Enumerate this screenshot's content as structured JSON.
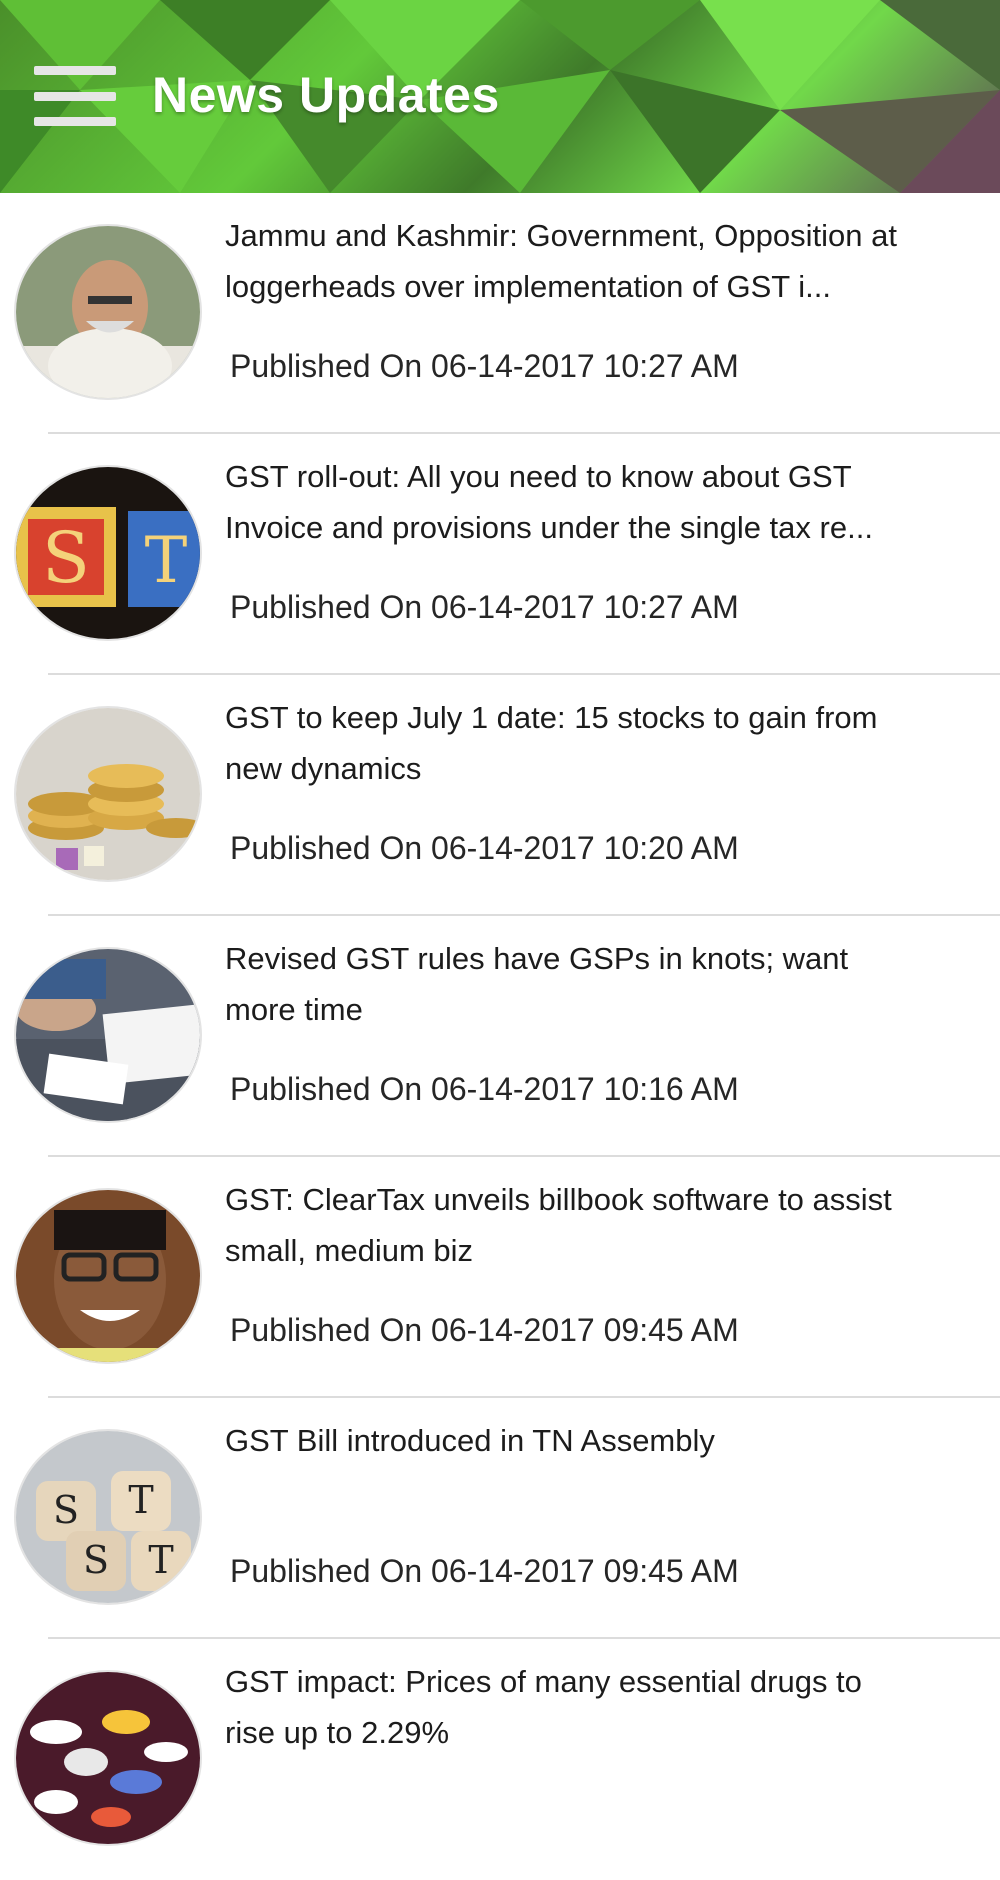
{
  "app_bar": {
    "title": "News Updates",
    "menu_icon": "hamburger-menu-icon"
  },
  "news": [
    {
      "title": "Jammu and Kashmir: Government, Opposition at loggerheads over implementation of GST i...",
      "date": "Published On 06-14-2017 10:27 AM"
    },
    {
      "title": "GST roll-out: All you need to know about GST Invoice and provisions under the single tax re...",
      "date": "Published On 06-14-2017 10:27 AM"
    },
    {
      "title": "GST to keep July 1 date: 15 stocks to gain from new dynamics",
      "date": "Published On 06-14-2017 10:20 AM"
    },
    {
      "title": "Revised GST rules have GSPs in knots; want more time",
      "date": "Published On 06-14-2017 10:16 AM"
    },
    {
      "title": "GST: ClearTax unveils billbook software to assist small, medium biz",
      "date": "Published On 06-14-2017 09:45 AM"
    },
    {
      "title": "GST Bill introduced in TN Assembly",
      "date": "Published On 06-14-2017 09:45 AM"
    },
    {
      "title": "GST impact: Prices of many essential drugs to rise up to 2.29%",
      "date": ""
    }
  ]
}
